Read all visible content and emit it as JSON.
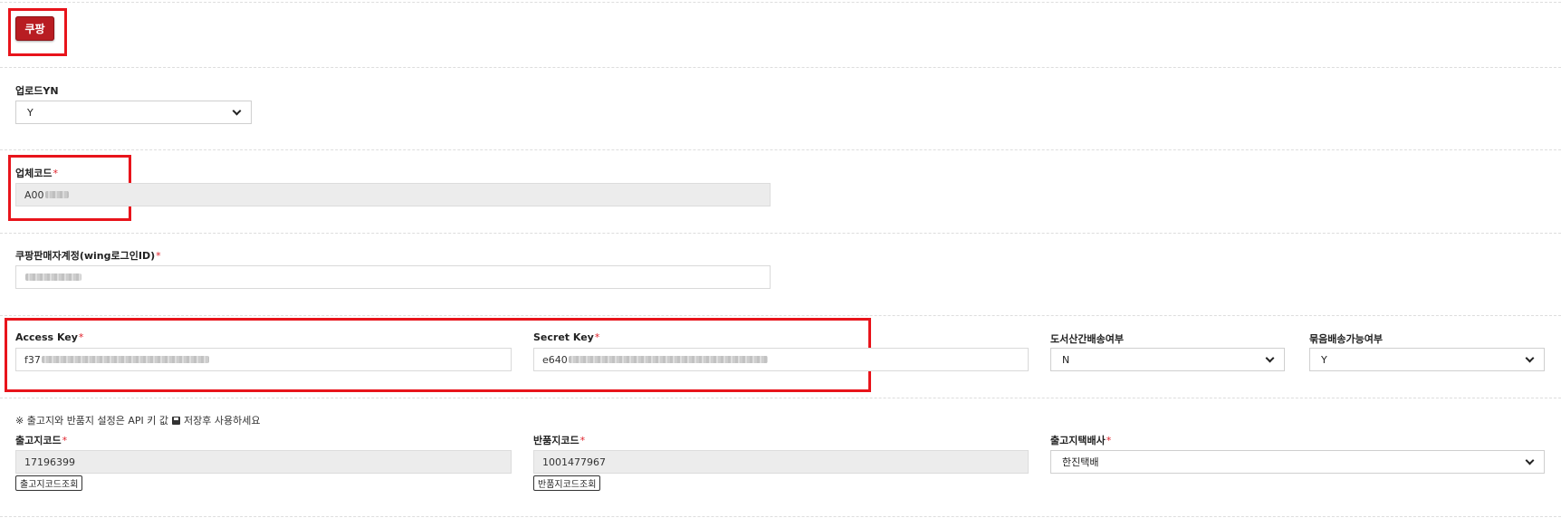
{
  "header": {
    "coupang_button": "쿠팡"
  },
  "upload_yn": {
    "label": "업로드YN",
    "value": "Y"
  },
  "vendor_code": {
    "label": "업체코드",
    "required_mark": "*",
    "value_prefix": "A00"
  },
  "seller_account": {
    "label": "쿠팡판매자계정(wing로그인ID)",
    "required_mark": "*"
  },
  "access_key": {
    "label": "Access Key",
    "required_mark": "*",
    "value_prefix": "f37"
  },
  "secret_key": {
    "label": "Secret Key",
    "required_mark": "*",
    "value_prefix": "e640"
  },
  "island_shipping": {
    "label": "도서산간배송여부",
    "value": "N"
  },
  "bundle_shipping": {
    "label": "묶음배송가능여부",
    "value": "Y"
  },
  "notice": {
    "text_before": "※ 출고지와 반품지 설정은 API 키 값",
    "text_after": "저장후 사용하세요",
    "icon": "save-icon"
  },
  "outbound_code": {
    "label": "출고지코드",
    "required_mark": "*",
    "value": "17196399",
    "lookup_button": "출고지코드조회"
  },
  "return_code": {
    "label": "반품지코드",
    "required_mark": "*",
    "value": "1001477967",
    "lookup_button": "반품지코드조회"
  },
  "courier": {
    "label": "출고지택배사",
    "required_mark": "*",
    "value": "한진택배"
  },
  "colors": {
    "brand": "#b81d22",
    "highlight": "#e8141b",
    "required": "#e0202a"
  }
}
